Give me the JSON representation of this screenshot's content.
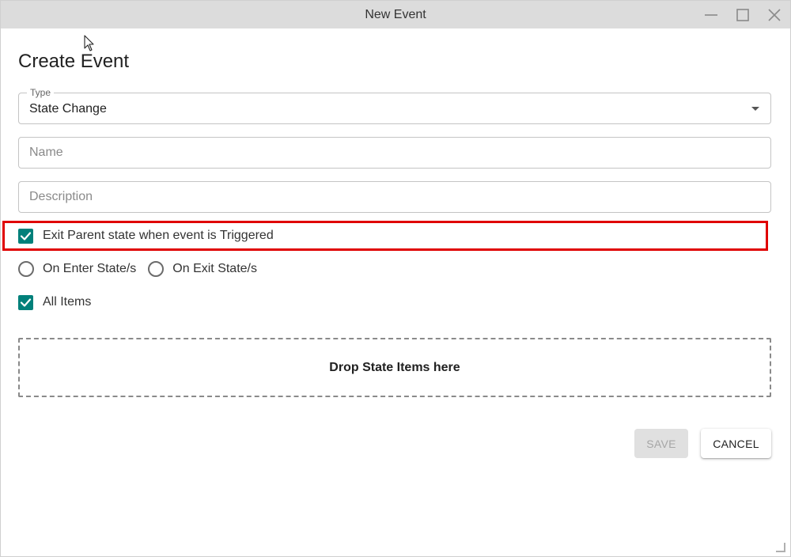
{
  "window": {
    "title": "New Event",
    "controls": {
      "minimize": "minimize-icon",
      "maximize": "maximize-icon",
      "close": "close-icon"
    }
  },
  "dialog": {
    "heading": "Create Event",
    "type_field": {
      "label": "Type",
      "value": "State Change"
    },
    "name_field": {
      "placeholder": "Name",
      "value": ""
    },
    "description_field": {
      "placeholder": "Description",
      "value": ""
    },
    "exit_parent_checkbox": {
      "label": "Exit Parent state when event is Triggered",
      "checked": true
    },
    "trigger_radios": [
      {
        "label": "On Enter State/s",
        "selected": false
      },
      {
        "label": "On Exit State/s",
        "selected": false
      }
    ],
    "all_items_checkbox": {
      "label": "All Items",
      "checked": true
    },
    "dropzone": {
      "text": "Drop State Items here"
    },
    "buttons": {
      "save": "SAVE",
      "cancel": "CANCEL"
    }
  },
  "colors": {
    "accent": "#00807a",
    "highlight": "#e00000",
    "titlebar": "#dcdcdc",
    "disabled_button": "#e0e0e0"
  }
}
